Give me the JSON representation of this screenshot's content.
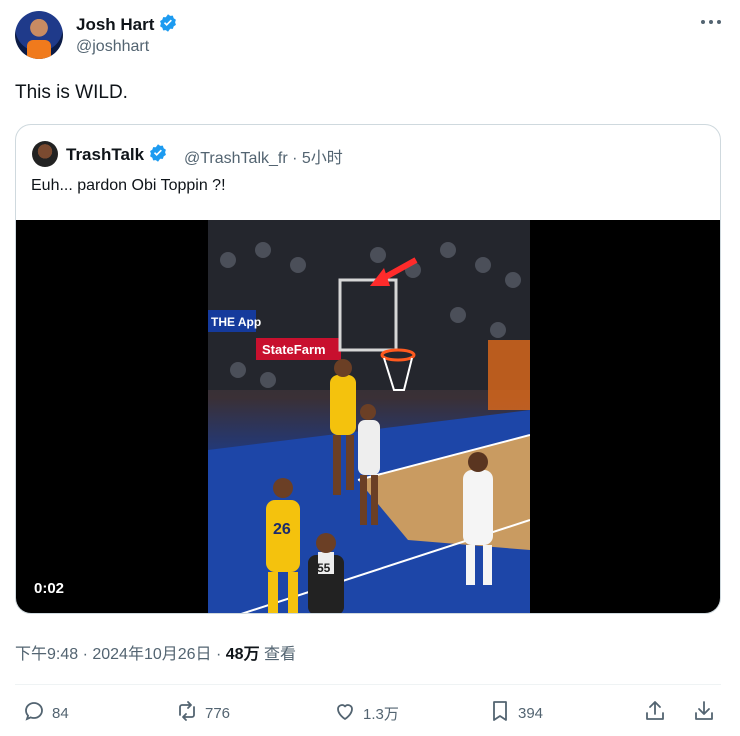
{
  "author": {
    "name": "Josh Hart",
    "handle": "@joshhart",
    "verified": true
  },
  "tweet": {
    "text": "This is WILD."
  },
  "quoted": {
    "name": "TrashTalk",
    "handle": "@TrashTalk_fr",
    "separator": "·",
    "time": "5小时",
    "text": "Euh... pardon Obi Toppin ?!",
    "video": {
      "duration": "0:02",
      "court_signs": [
        "THE App",
        "StateFarm"
      ],
      "jersey_numbers": [
        "26",
        "55"
      ]
    }
  },
  "meta": {
    "timestamp": "下午9:48 · 2024年10月26日 · ",
    "views_count": "48万",
    "views_label": " 查看"
  },
  "actions": {
    "replies": "84",
    "reposts": "776",
    "likes": "1.3万",
    "bookmarks": "394"
  },
  "colors": {
    "verified": "#1d9bf0",
    "text_secondary": "#536471",
    "border": "#cfd9de"
  }
}
